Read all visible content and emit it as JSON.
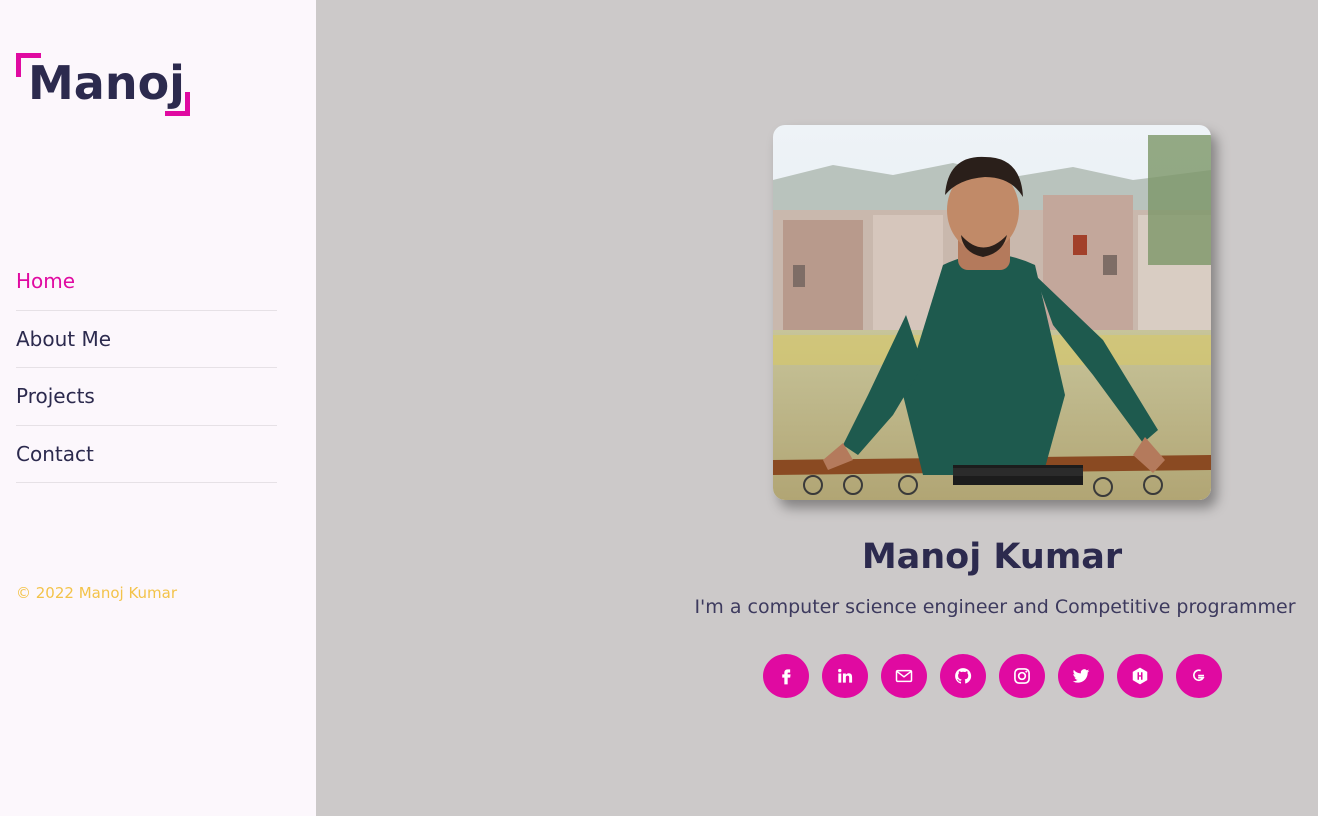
{
  "logo": {
    "text": "Manoj"
  },
  "nav": {
    "items": [
      {
        "label": "Home",
        "active": true
      },
      {
        "label": "About Me",
        "active": false
      },
      {
        "label": "Projects",
        "active": false
      },
      {
        "label": "Contact",
        "active": false
      }
    ]
  },
  "footer": {
    "copyright": "© 2022 Manoj Kumar"
  },
  "profile": {
    "name": "Manoj Kumar",
    "tagline": "I'm a computer science engineer and Competitive programmer"
  },
  "socials": [
    {
      "icon": "facebook-icon"
    },
    {
      "icon": "linkedin-icon"
    },
    {
      "icon": "mail-icon"
    },
    {
      "icon": "github-icon"
    },
    {
      "icon": "instagram-icon"
    },
    {
      "icon": "twitter-icon"
    },
    {
      "icon": "hackerrank-icon"
    },
    {
      "icon": "geeksforgeeks-icon"
    }
  ],
  "colors": {
    "accent": "#e00aa1",
    "text": "#2c2a4e",
    "sidebar_bg": "#fcf7fc",
    "main_bg": "#ccc9c9",
    "copyright": "#f3c34a"
  }
}
